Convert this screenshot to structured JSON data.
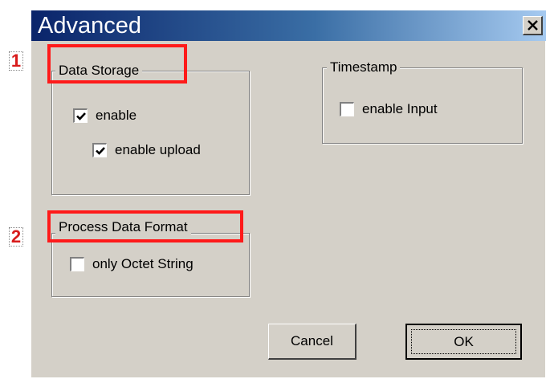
{
  "markers": [
    "1",
    "2"
  ],
  "dialog": {
    "title": "Advanced",
    "close_icon": "close-x-icon"
  },
  "data_storage": {
    "label": "Data Storage",
    "enable": {
      "label": "enable",
      "checked": true
    },
    "enable_upload": {
      "label": "enable upload",
      "checked": true
    }
  },
  "timestamp": {
    "label": "Timestamp",
    "enable_input": {
      "label": "enable Input",
      "checked": false
    }
  },
  "process_data_format": {
    "label": "Process Data Format",
    "only_octet_string": {
      "label": "only Octet String",
      "checked": false
    }
  },
  "buttons": {
    "cancel": "Cancel",
    "ok": "OK"
  },
  "colors": {
    "highlight": "#ff1a1a",
    "marker_text": "#d81b1b",
    "dialog_face": "#d4d0c8",
    "titlebar_start": "#0a246a",
    "titlebar_end": "#a6caf0"
  }
}
